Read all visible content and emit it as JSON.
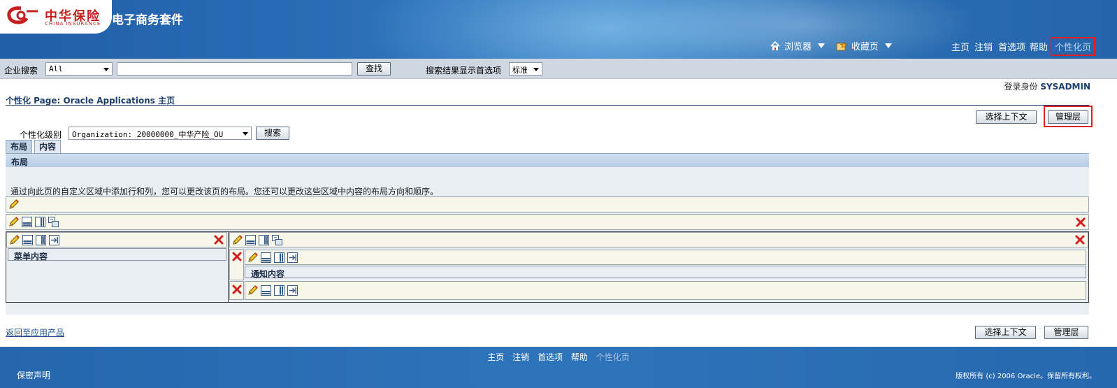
{
  "header": {
    "logo_cn": "中华保险",
    "logo_en": "CHINA INSURANCE",
    "app_title": "电子商务套件",
    "menus": [
      {
        "label": "浏览器",
        "icon": "home-icon"
      },
      {
        "label": "收藏页",
        "icon": "favorites-icon"
      }
    ],
    "links": [
      "主页",
      "注销",
      "首选项",
      "帮助",
      "个性化页"
    ]
  },
  "search": {
    "label": "企业搜索",
    "scope_value": "All",
    "query_value": "",
    "go_label": "查找",
    "pref_label": "搜索结果显示首选项",
    "pref_value": "标准"
  },
  "login": {
    "label": "登录身份",
    "user": "SYSADMIN"
  },
  "page": {
    "title": "个性化 Page: Oracle Applications 主页",
    "select_context_label": "选择上下文",
    "manage_levels_label": "管理层",
    "level_label": "个性化级别",
    "level_value": "Organization: 20000000_中华产险_OU",
    "search_button": "搜索",
    "tabs": [
      {
        "label": "布局",
        "active": true
      },
      {
        "label": "内容",
        "active": false
      }
    ],
    "section_header": "布局",
    "description": "通过向此页的自定义区域中添加行和列，您可以更改该页的布局。您还可以更改这些区域中内容的布局方向和顺序。",
    "regions": {
      "menu": "菜单内容",
      "notify": "通知内容"
    },
    "back_link": "返回至应用产品"
  },
  "footer": {
    "links": [
      "主页",
      "注销",
      "首选项",
      "帮助"
    ],
    "current": "个性化页",
    "privacy": "保密声明",
    "copyright": "版权所有 (c) 2006 Oracle。保留所有权利。"
  },
  "colors": {
    "header_blue": "#2a6db6",
    "highlight_red": "#e02020",
    "link_blue": "#1b4f8a"
  }
}
